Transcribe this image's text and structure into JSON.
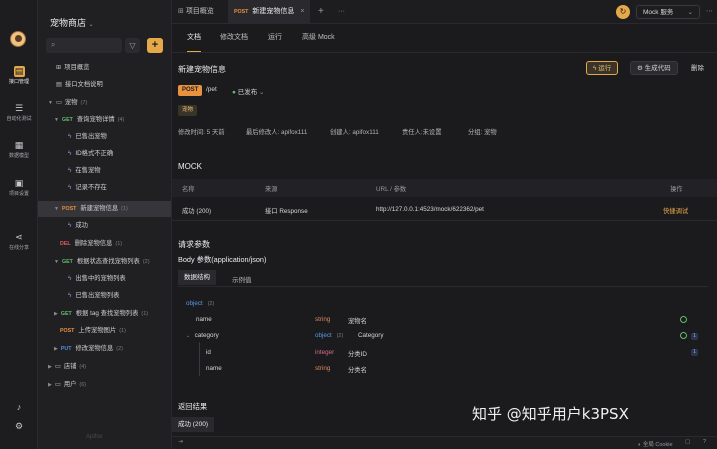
{
  "rail": {
    "items": [
      {
        "label": "接口管理",
        "icon": "api-icon"
      },
      {
        "label": "自动化测试",
        "icon": "test-icon"
      },
      {
        "label": "数据模型",
        "icon": "model-icon"
      },
      {
        "label": "项目设置",
        "icon": "settings-icon"
      },
      {
        "label": "在线分享",
        "icon": "share-icon"
      }
    ]
  },
  "sidebar": {
    "project_title": "宠物商店",
    "overview": "项目概览",
    "doc_desc": "接口文档说明",
    "tree": {
      "folder_pet": {
        "label": "宠物",
        "count": "(7)"
      },
      "get_pet": {
        "method": "GET",
        "label": "查询宠物详情",
        "count": "(4)"
      },
      "case1": "已售出宠物",
      "case2": "ID格式不正确",
      "case3": "在售宠物",
      "case4": "记录不存在",
      "post_pet": {
        "method": "POST",
        "label": "新建宠物信息",
        "count": "(1)"
      },
      "case5": "成功",
      "del_pet": {
        "method": "DEL",
        "label": "删除宠物信息",
        "count": "(1)"
      },
      "get_status": {
        "method": "GET",
        "label": "根据状态查找宠物列表",
        "count": "(2)"
      },
      "case6": "出售中的宠物列表",
      "case7": "已售出宠物列表",
      "get_tag": {
        "method": "GET",
        "label": "根据 tag 查找宠物列表",
        "count": "(1)"
      },
      "post_img": {
        "method": "POST",
        "label": "上传宠物图片",
        "count": "(1)"
      },
      "put_pet": {
        "method": "PUT",
        "label": "修改宠物信息",
        "count": "(2)"
      },
      "folder_store": {
        "label": "店铺",
        "count": "(4)"
      },
      "folder_user": {
        "label": "用户",
        "count": "(6)"
      }
    },
    "footer_logo": "Apifox"
  },
  "topbar": {
    "tab1": "项目概览",
    "tab2_method": "POST",
    "tab2": "新建宠物信息",
    "close": "×",
    "add": "+",
    "more": "···",
    "mock_service": "Mock 服务"
  },
  "subtabs": [
    "文档",
    "修改文档",
    "运行",
    "高级 Mock"
  ],
  "api": {
    "title": "新建宠物信息",
    "run": "运行",
    "gen_code": "生成代码",
    "delete": "删除",
    "method": "POST",
    "path": "/pet",
    "status": "已发布",
    "tag": "宠物",
    "meta": {
      "modified": "修改时间: 5 天前",
      "modifier": "最后修改人: apifox111",
      "creator": "创建人: apifox111",
      "owner": "责任人:未设置",
      "group": "分组: 宠物"
    }
  },
  "mock": {
    "heading": "MOCK",
    "headers": [
      "名称",
      "来源",
      "URL / 参数",
      "操作"
    ],
    "row": {
      "name": "成功 (200)",
      "source": "接口 Response",
      "url": "http://127.0.0.1:4523/mock/622362/pet",
      "action": "快捷调试"
    }
  },
  "request": {
    "heading": "请求参数",
    "body_label": "Body 参数(application/json)",
    "tabs": [
      "数据结构",
      "示例值"
    ],
    "root": {
      "name": "object",
      "count": "(2)"
    },
    "fields": [
      {
        "name": "name",
        "type": "string",
        "desc": "宠物名"
      },
      {
        "name": "category",
        "type": "object",
        "count": "(2)",
        "desc": "Category",
        "badge": "1"
      },
      {
        "name": "id",
        "type": "integer",
        "desc": "分类ID",
        "badge": "1"
      },
      {
        "name": "name",
        "type": "string",
        "desc": "分类名"
      }
    ]
  },
  "response": {
    "heading": "返回结果",
    "tab": "成功 (200)"
  },
  "statusbar": {
    "cookie": "全局 Cookie"
  },
  "watermark": "知乎 @知乎用户k3PSX"
}
